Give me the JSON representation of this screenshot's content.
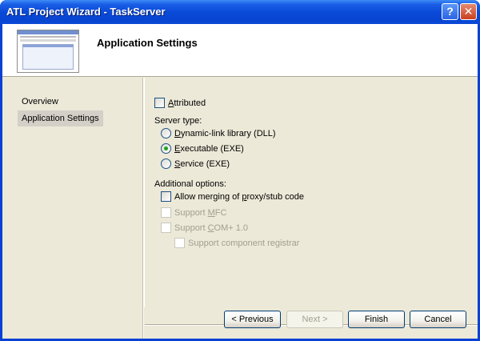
{
  "window": {
    "title": "ATL Project Wizard - TaskServer",
    "help_glyph": "?",
    "close_glyph": "✕"
  },
  "header": {
    "title": "Application Settings"
  },
  "nav": {
    "items": [
      {
        "label": "Overview",
        "selected": false
      },
      {
        "label": "Application Settings",
        "selected": true
      }
    ]
  },
  "options": {
    "attributed": {
      "pre": "",
      "ul": "A",
      "post": "ttributed",
      "checked": false
    },
    "server_type_label": "Server type:",
    "server_types": [
      {
        "pre": "",
        "ul": "D",
        "post": "ynamic-link library (DLL)",
        "selected": false
      },
      {
        "pre": "",
        "ul": "E",
        "post": "xecutable (EXE)",
        "selected": true
      },
      {
        "pre": "",
        "ul": "S",
        "post": "ervice (EXE)",
        "selected": false
      }
    ],
    "additional_label": "Additional options:",
    "additional": [
      {
        "pre": "Allow merging of ",
        "ul": "p",
        "post": "roxy/stub code",
        "checked": false,
        "enabled": true
      },
      {
        "pre": "Support ",
        "ul": "M",
        "post": "FC",
        "checked": false,
        "enabled": false
      },
      {
        "pre": "Support ",
        "ul": "C",
        "post": "OM+ 1.0",
        "checked": false,
        "enabled": false
      },
      {
        "pre": "Support component registrar",
        "ul": "",
        "post": "",
        "checked": false,
        "enabled": false
      }
    ]
  },
  "buttons": {
    "previous": "< Previous",
    "next": "Next >",
    "finish": "Finish",
    "cancel": "Cancel"
  },
  "colors": {
    "titlebar": "#0a4ad8",
    "dialog_bg": "#ece9d8",
    "radio_dot": "#21a121"
  }
}
